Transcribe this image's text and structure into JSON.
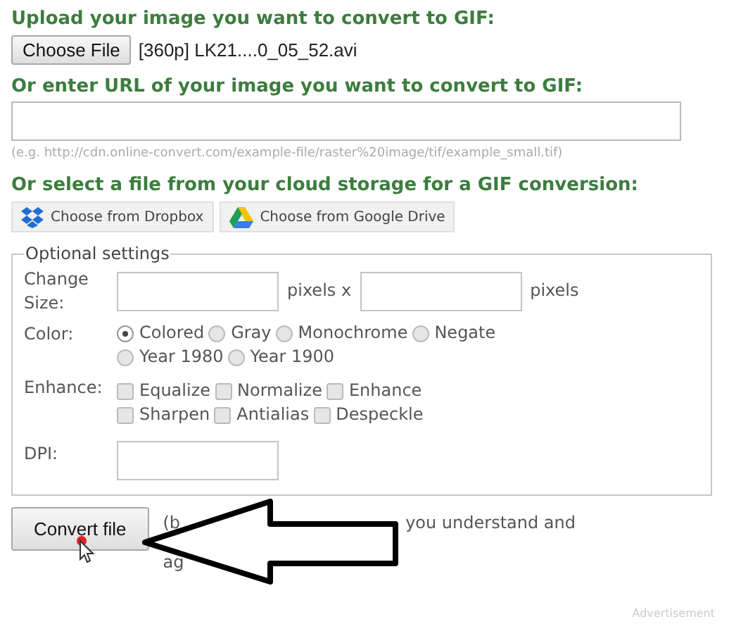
{
  "upload": {
    "heading": "Upload your image you want to convert to GIF:",
    "button": "Choose File",
    "file_name": "[360p] LK21....0_05_52.avi"
  },
  "url": {
    "heading": "Or enter URL of your image you want to convert to GIF:",
    "hint": "(e.g. http://cdn.online-convert.com/example-file/raster%20image/tif/example_small.tif)"
  },
  "cloud": {
    "heading": "Or select a file from your cloud storage for a GIF conversion:",
    "buttons": [
      {
        "label": "Choose from Dropbox",
        "kind": "dropbox"
      },
      {
        "label": "Choose from Google Drive",
        "kind": "drive"
      }
    ]
  },
  "optional_settings": {
    "legend": "Optional settings",
    "size": {
      "label": "Change Size:",
      "unit_1": "pixels x",
      "unit_2": "pixels"
    },
    "color": {
      "label": "Color:",
      "options": [
        {
          "label": "Colored",
          "selected": true
        },
        {
          "label": "Gray",
          "selected": false
        },
        {
          "label": "Monochrome",
          "selected": false
        },
        {
          "label": "Negate",
          "selected": false
        },
        {
          "label": "Year 1980",
          "selected": false
        },
        {
          "label": "Year 1900",
          "selected": false
        }
      ]
    },
    "enhance": {
      "label": "Enhance:",
      "options": [
        {
          "label": "Equalize",
          "checked": false
        },
        {
          "label": "Normalize",
          "checked": false
        },
        {
          "label": "Enhance",
          "checked": false
        },
        {
          "label": "Sharpen",
          "checked": false
        },
        {
          "label": "Antialias",
          "checked": false
        },
        {
          "label": "Despeckle",
          "checked": false
        }
      ]
    },
    "dpi": {
      "label": "DPI:"
    }
  },
  "convert": {
    "button": "Convert file",
    "note_parts": [
      "(b",
      "you understand and",
      "ag"
    ]
  },
  "advertisement": "Advertisement"
}
